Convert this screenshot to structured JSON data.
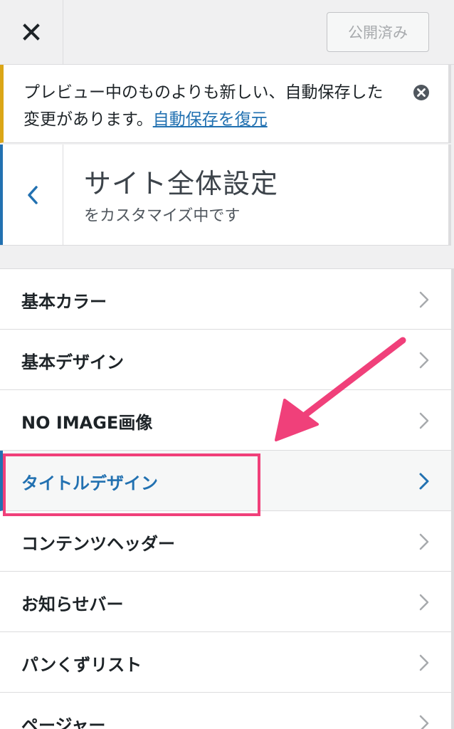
{
  "header": {
    "close_icon": "close-icon",
    "publish_label": "公開済み"
  },
  "notice": {
    "text": "プレビュー中のものよりも新しい、自動保存した変更があります。",
    "link": "自動保存を復元",
    "dismiss_icon": "dismiss-circle-icon",
    "accent_color": "#dba617"
  },
  "section": {
    "back_icon": "chevron-left-icon",
    "title": "サイト全体設定",
    "subtitle": "をカスタマイズ中です"
  },
  "menu": {
    "items": [
      {
        "label": "基本カラー"
      },
      {
        "label": "基本デザイン"
      },
      {
        "label": "NO IMAGE画像"
      },
      {
        "label": "タイトルデザイン"
      },
      {
        "label": "コンテンツヘッダー"
      },
      {
        "label": "お知らせバー"
      },
      {
        "label": "パンくずリスト"
      },
      {
        "label": "ページャー"
      }
    ],
    "active_item": "タイトルデザイン",
    "chevron_icon": "chevron-right-icon",
    "accent_color": "#2271b1"
  },
  "annotation": {
    "color": "#f0407a",
    "arrow_icon": "arrow-icon"
  }
}
